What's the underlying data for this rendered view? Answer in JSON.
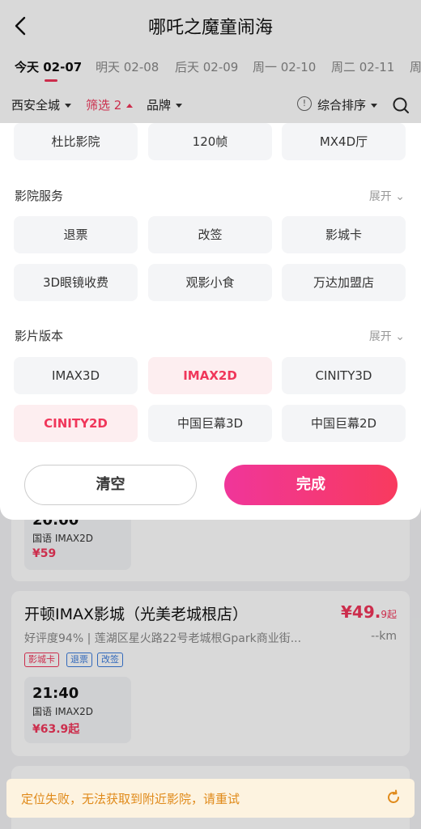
{
  "header": {
    "title": "哪吒之魔童闹海"
  },
  "dates": [
    {
      "label": "今天 02-07",
      "active": true
    },
    {
      "label": "明天 02-08"
    },
    {
      "label": "后天 02-09"
    },
    {
      "label": "周一 02-10"
    },
    {
      "label": "周二 02-11"
    },
    {
      "label": "周"
    }
  ],
  "filterbar": {
    "city": "西安全城",
    "filter": "筛选 2",
    "brand": "品牌",
    "sort": "综合排序"
  },
  "panel": {
    "top_row": [
      "杜比影院",
      "120帧",
      "MX4D厅"
    ],
    "services_title": "影院服务",
    "expand": "展开",
    "services": [
      "退票",
      "改签",
      "影城卡",
      "3D眼镜收费",
      "观影小食",
      "万达加盟店"
    ],
    "versions_title": "影片版本",
    "versions": [
      "IMAX3D",
      "IMAX2D",
      "CINITY3D",
      "CINITY2D",
      "中国巨幕3D",
      "中国巨幕2D"
    ],
    "clear": "清空",
    "done": "完成"
  },
  "list": {
    "card1_show": {
      "time": "20:00",
      "version": "国语 IMAX2D",
      "price": "¥59"
    },
    "card2": {
      "name": "开顿IMAX影城（光美老城根店）",
      "price": "¥49.",
      "price_small": "9起",
      "addr": "好评度94% | 莲湖区星火路22号老城根Gpark商业街...",
      "dist": "--km",
      "tags": [
        "影城卡",
        "退票",
        "改签"
      ],
      "show": {
        "time": "21:40",
        "version": "国语 IMAX2D",
        "price": "¥63.9起"
      }
    }
  },
  "toast": "定位失败，无法获取到附近影院，请重试"
}
